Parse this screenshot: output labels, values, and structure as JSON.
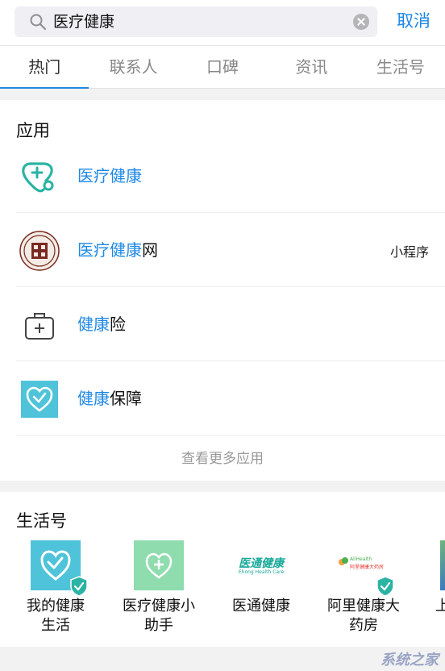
{
  "search": {
    "query": "医疗健康",
    "cancel_label": "取消"
  },
  "tabs": [
    {
      "label": "热门"
    },
    {
      "label": "联系人"
    },
    {
      "label": "口碑"
    },
    {
      "label": "资讯"
    },
    {
      "label": "生活号"
    }
  ],
  "apps": {
    "title": "应用",
    "items": [
      {
        "hl": "医疗健康",
        "rest": "",
        "tag": "",
        "icon": "stethoscope-icon"
      },
      {
        "hl": "医疗健康",
        "rest": "网",
        "tag": "小程序",
        "icon": "seal-logo"
      },
      {
        "hl": "健康",
        "rest": "险",
        "tag": "",
        "icon": "medical-kit-icon"
      },
      {
        "hl": "健康",
        "rest": "保障",
        "tag": "",
        "icon": "heart-shield-icon"
      }
    ],
    "more_label": "查看更多应用"
  },
  "life": {
    "title": "生活号",
    "accounts": [
      {
        "line1": "我的健康",
        "line2": "生活"
      },
      {
        "line1": "医疗健康小",
        "line2": "助手"
      },
      {
        "line1": "医通健康",
        "line2": "",
        "logo_text": "医通健康",
        "logo_sub": "Ehong Health Care"
      },
      {
        "line1": "阿里健康大",
        "line2": "药房",
        "logo_text": "阿里健康大药房",
        "logo_sub": "AliHealth"
      },
      {
        "line1": "上",
        "line2": ""
      }
    ]
  },
  "colors": {
    "accent": "#1e88e5",
    "teal": "#2bb3a3",
    "cyan": "#4fc3d9",
    "mint": "#8fdcae"
  },
  "watermark": "系统之家"
}
